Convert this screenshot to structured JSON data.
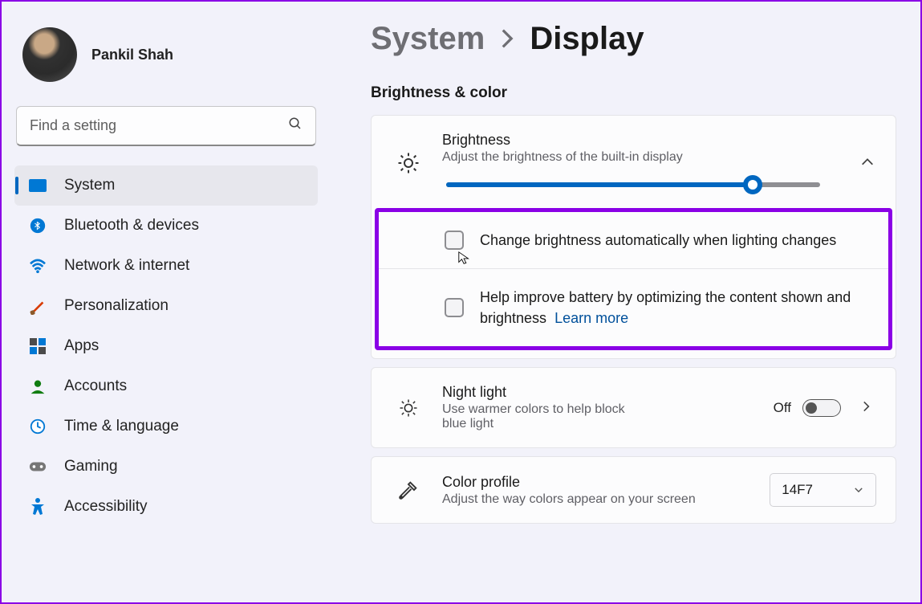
{
  "profile": {
    "name": "Pankil Shah"
  },
  "search": {
    "placeholder": "Find a setting"
  },
  "nav": [
    {
      "key": "system",
      "label": "System"
    },
    {
      "key": "bluetooth",
      "label": "Bluetooth & devices"
    },
    {
      "key": "network",
      "label": "Network & internet"
    },
    {
      "key": "personalization",
      "label": "Personalization"
    },
    {
      "key": "apps",
      "label": "Apps"
    },
    {
      "key": "accounts",
      "label": "Accounts"
    },
    {
      "key": "time",
      "label": "Time & language"
    },
    {
      "key": "gaming",
      "label": "Gaming"
    },
    {
      "key": "accessibility",
      "label": "Accessibility"
    }
  ],
  "breadcrumb": {
    "parent": "System",
    "current": "Display"
  },
  "section_title": "Brightness & color",
  "brightness": {
    "title": "Brightness",
    "subtitle": "Adjust the brightness of the built-in display",
    "value_percent": 82,
    "checkbox_auto": "Change brightness automatically when lighting changes",
    "checkbox_battery": "Help improve battery by optimizing the content shown and brightness",
    "learn_more": "Learn more"
  },
  "nightlight": {
    "title": "Night light",
    "subtitle": "Use warmer colors to help block blue light",
    "state": "Off"
  },
  "colorprofile": {
    "title": "Color profile",
    "subtitle": "Adjust the way colors appear on your screen",
    "selected": "14F7"
  }
}
